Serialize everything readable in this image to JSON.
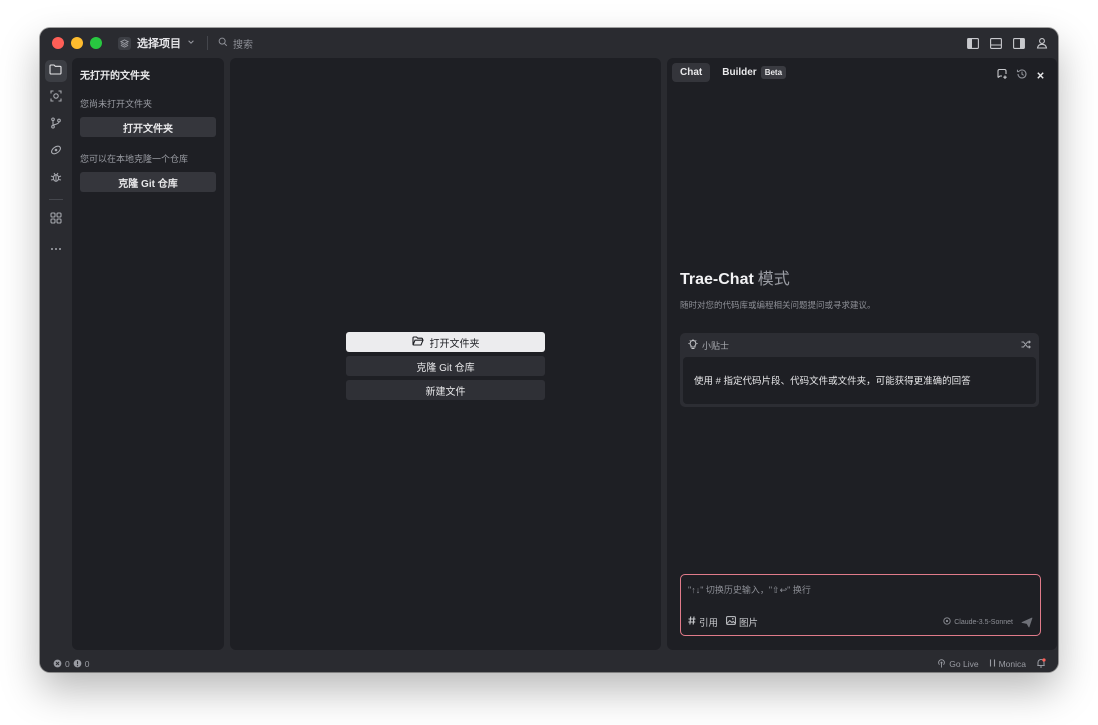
{
  "titlebar": {
    "project_label": "选择项目",
    "search_placeholder": "搜索"
  },
  "explorer": {
    "title": "无打开的文件夹",
    "no_folder_note": "您尚未打开文件夹",
    "open_folder_button": "打开文件夹",
    "clone_note": "您可以在本地克隆一个仓库",
    "clone_button": "克隆 Git 仓库"
  },
  "editor": {
    "open_folder": "打开文件夹",
    "clone_repo": "克隆 Git 仓库",
    "new_file": "新建文件"
  },
  "chat": {
    "tabs": [
      {
        "label": "Chat"
      },
      {
        "label": "Builder",
        "badge": "Beta"
      }
    ],
    "heading": "Trae-Chat",
    "heading_mode": "模式",
    "subtitle": "随时对您的代码库或编程相关问题提问或寻求建议。",
    "tip": {
      "label": "小贴士",
      "text": "使用 # 指定代码片段、代码文件或文件夹，可能获得更准确的回答"
    },
    "input": {
      "placeholder": "\"↑↓\" 切换历史输入，\"⇧↩\" 换行",
      "reference_label": "引用",
      "image_label": "图片",
      "model": "Claude-3.5-Sonnet"
    }
  },
  "statusbar": {
    "errors": "0",
    "warnings": "0",
    "go_live": "Go Live",
    "monica": "Monica"
  },
  "colors": {
    "window_bg": "#2a2b30",
    "panel_bg": "#1e1f24",
    "input_border": "#e07b8a",
    "traffic_red": "#ff5f57",
    "traffic_yellow": "#febc2e",
    "traffic_green": "#28c840"
  },
  "icons": [
    "folder-icon",
    "search-scan-icon",
    "source-control-icon",
    "remote-link-icon",
    "debug-icon",
    "extensions-icon",
    "more-icon",
    "layout-left-icon",
    "layout-bottom-icon",
    "layout-right-icon",
    "account-icon",
    "new-chat-icon",
    "history-icon",
    "close-icon",
    "lightbulb-icon",
    "shuffle-icon",
    "send-icon",
    "bell-icon"
  ]
}
